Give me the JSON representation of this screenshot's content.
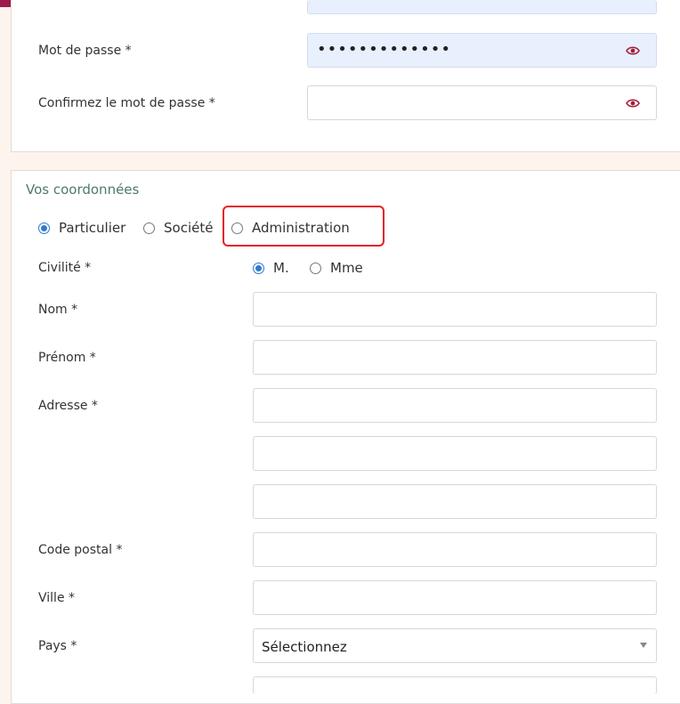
{
  "account": {
    "password_label": "Mot de passe *",
    "password_value": "•••••••••••••",
    "confirm_label": "Confirmez le mot de passe *"
  },
  "coordinates": {
    "section_title": "Vos coordonnées",
    "type_options": [
      {
        "label": "Particulier",
        "checked": true
      },
      {
        "label": "Société",
        "checked": false
      },
      {
        "label": "Administration",
        "checked": false
      }
    ],
    "civility_label": "Civilité *",
    "civility_options": [
      {
        "label": "M.",
        "checked": true
      },
      {
        "label": "Mme",
        "checked": false
      }
    ],
    "nom_label": "Nom *",
    "prenom_label": "Prénom *",
    "adresse_label": "Adresse *",
    "code_postal_label": "Code postal *",
    "ville_label": "Ville *",
    "pays_label": "Pays *",
    "pays_selected": "Sélectionnez"
  },
  "colors": {
    "brand": "#9b1b4e",
    "section_title": "#4e7a6e",
    "radio_accent": "#2f7ad1",
    "highlight": "#e31e24"
  }
}
